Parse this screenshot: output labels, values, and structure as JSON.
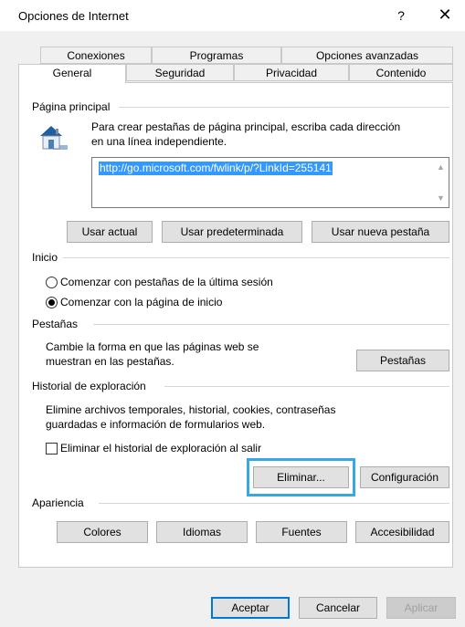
{
  "window": {
    "title": "Opciones de Internet",
    "help_label": "?",
    "close_label": "✕"
  },
  "tabs": {
    "row_back": [
      "Conexiones",
      "Programas",
      "Opciones avanzadas"
    ],
    "row_front": [
      "General",
      "Seguridad",
      "Privacidad",
      "Contenido"
    ],
    "active": "General"
  },
  "home_page": {
    "group_label": "Página principal",
    "description_line1": "Para crear pestañas de página principal, escriba cada dirección",
    "description_line2": "en una línea independiente.",
    "url_value": "http://go.microsoft.com/fwlink/p/?LinkId=255141",
    "icon": "home-page-icon",
    "buttons": [
      "Usar actual",
      "Usar predeterminada",
      "Usar nueva pestaña"
    ]
  },
  "startup": {
    "group_label": "Inicio",
    "options": [
      {
        "label": "Comenzar con pestañas de la última sesión",
        "checked": false
      },
      {
        "label": "Comenzar con la página de inicio",
        "checked": true
      }
    ]
  },
  "tabs_section": {
    "group_label": "Pestañas",
    "description_line1": "Cambie la forma en que las páginas web se",
    "description_line2": "muestran en las pestañas.",
    "button": "Pestañas"
  },
  "history": {
    "group_label": "Historial de exploración",
    "description_line1": "Elimine archivos temporales, historial, cookies, contraseñas",
    "description_line2": "guardadas e información de formularios web.",
    "checkbox_label": "Eliminar el historial de exploración al salir",
    "checkbox_checked": false,
    "delete_button": "Eliminar...",
    "settings_button": "Configuración",
    "highlight_color": "#39a8e0"
  },
  "appearance": {
    "group_label": "Apariencia",
    "buttons": [
      "Colores",
      "Idiomas",
      "Fuentes",
      "Accesibilidad"
    ]
  },
  "footer": {
    "ok": "Aceptar",
    "cancel": "Cancelar",
    "apply": "Aplicar"
  }
}
